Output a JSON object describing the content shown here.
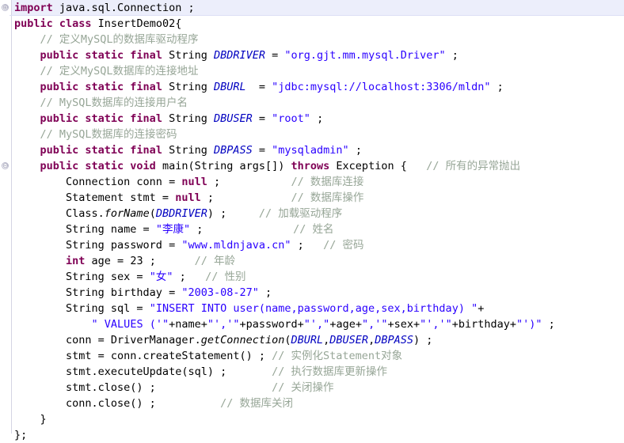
{
  "editor": {
    "name": "java-source-editor",
    "language": "Java",
    "file_class": "InsertDemo02",
    "colors": {
      "background": "#ffffff",
      "current_line_highlight": "#eceefb",
      "keyword": "#7f0055",
      "string": "#2a00ff",
      "comment": "#97a697",
      "field": "#0000c0",
      "plain": "#000000",
      "gutter_rule": "#d4d4e4"
    }
  },
  "gutter": {
    "markers": [
      {
        "line": 1,
        "icon": "fold-expand-icon",
        "glyph": "⊕"
      },
      {
        "line": 11,
        "icon": "fold-collapse-icon",
        "glyph": "⊖"
      }
    ]
  },
  "lines": [
    {
      "n": 1,
      "current": true,
      "tokens": [
        {
          "t": "kw",
          "v": "import"
        },
        {
          "t": "pln",
          "v": " java.sql.Connection ;"
        }
      ]
    },
    {
      "n": 2,
      "tokens": [
        {
          "t": "kw",
          "v": "public class"
        },
        {
          "t": "pln",
          "v": " InsertDemo02{"
        }
      ]
    },
    {
      "n": 3,
      "tokens": [
        {
          "t": "pln",
          "v": "    "
        },
        {
          "t": "cmt",
          "v": "// 定义MySQL的数据库驱动程序"
        }
      ]
    },
    {
      "n": 4,
      "tokens": [
        {
          "t": "pln",
          "v": "    "
        },
        {
          "t": "kw",
          "v": "public static final"
        },
        {
          "t": "pln",
          "v": " String "
        },
        {
          "t": "fld",
          "v": "DBDRIVER"
        },
        {
          "t": "pln",
          "v": " = "
        },
        {
          "t": "str",
          "v": "\"org.gjt.mm.mysql.Driver\""
        },
        {
          "t": "pln",
          "v": " ;"
        }
      ]
    },
    {
      "n": 5,
      "tokens": [
        {
          "t": "pln",
          "v": "    "
        },
        {
          "t": "cmt",
          "v": "// 定义MySQL数据库的连接地址"
        }
      ]
    },
    {
      "n": 6,
      "tokens": [
        {
          "t": "pln",
          "v": "    "
        },
        {
          "t": "kw",
          "v": "public static final"
        },
        {
          "t": "pln",
          "v": " String "
        },
        {
          "t": "fld",
          "v": "DBURL"
        },
        {
          "t": "pln",
          "v": "  = "
        },
        {
          "t": "str",
          "v": "\"jdbc:mysql://localhost:3306/mldn\""
        },
        {
          "t": "pln",
          "v": " ;"
        }
      ]
    },
    {
      "n": 7,
      "tokens": [
        {
          "t": "pln",
          "v": "    "
        },
        {
          "t": "cmt",
          "v": "// MySQL数据库的连接用户名"
        }
      ]
    },
    {
      "n": 8,
      "tokens": [
        {
          "t": "pln",
          "v": "    "
        },
        {
          "t": "kw",
          "v": "public static final"
        },
        {
          "t": "pln",
          "v": " String "
        },
        {
          "t": "fld",
          "v": "DBUSER"
        },
        {
          "t": "pln",
          "v": " = "
        },
        {
          "t": "str",
          "v": "\"root\""
        },
        {
          "t": "pln",
          "v": " ;"
        }
      ]
    },
    {
      "n": 9,
      "tokens": [
        {
          "t": "pln",
          "v": "    "
        },
        {
          "t": "cmt",
          "v": "// MySQL数据库的连接密码"
        }
      ]
    },
    {
      "n": 10,
      "tokens": [
        {
          "t": "pln",
          "v": "    "
        },
        {
          "t": "kw",
          "v": "public static final"
        },
        {
          "t": "pln",
          "v": " String "
        },
        {
          "t": "fld",
          "v": "DBPASS"
        },
        {
          "t": "pln",
          "v": " = "
        },
        {
          "t": "str",
          "v": "\"mysqladmin\""
        },
        {
          "t": "pln",
          "v": " ;"
        }
      ]
    },
    {
      "n": 11,
      "tokens": [
        {
          "t": "pln",
          "v": "    "
        },
        {
          "t": "kw",
          "v": "public static void"
        },
        {
          "t": "pln",
          "v": " main(String args[]) "
        },
        {
          "t": "kw",
          "v": "throws"
        },
        {
          "t": "pln",
          "v": " Exception {   "
        },
        {
          "t": "cmt",
          "v": "// 所有的异常抛出"
        }
      ]
    },
    {
      "n": 12,
      "tokens": [
        {
          "t": "pln",
          "v": "        Connection conn = "
        },
        {
          "t": "kw",
          "v": "null"
        },
        {
          "t": "pln",
          "v": " ;           "
        },
        {
          "t": "cmt",
          "v": "// 数据库连接"
        }
      ]
    },
    {
      "n": 13,
      "tokens": [
        {
          "t": "pln",
          "v": "        Statement stmt = "
        },
        {
          "t": "kw",
          "v": "null"
        },
        {
          "t": "pln",
          "v": " ;            "
        },
        {
          "t": "cmt",
          "v": "// 数据库操作"
        }
      ]
    },
    {
      "n": 14,
      "tokens": [
        {
          "t": "pln",
          "v": "        Class."
        },
        {
          "t": "mth",
          "v": "forName"
        },
        {
          "t": "pln",
          "v": "("
        },
        {
          "t": "fld",
          "v": "DBDRIVER"
        },
        {
          "t": "pln",
          "v": ") ;     "
        },
        {
          "t": "cmt",
          "v": "// 加载驱动程序"
        }
      ]
    },
    {
      "n": 15,
      "tokens": [
        {
          "t": "pln",
          "v": "        String name = "
        },
        {
          "t": "str",
          "v": "\"李康\""
        },
        {
          "t": "pln",
          "v": " ;              "
        },
        {
          "t": "cmt",
          "v": "// 姓名"
        }
      ]
    },
    {
      "n": 16,
      "tokens": [
        {
          "t": "pln",
          "v": "        String password = "
        },
        {
          "t": "str",
          "v": "\"www.mldnjava.cn\""
        },
        {
          "t": "pln",
          "v": " ;   "
        },
        {
          "t": "cmt",
          "v": "// 密码"
        }
      ]
    },
    {
      "n": 17,
      "tokens": [
        {
          "t": "pln",
          "v": "        "
        },
        {
          "t": "kw",
          "v": "int"
        },
        {
          "t": "pln",
          "v": " age = 23 ;      "
        },
        {
          "t": "cmt",
          "v": "// 年龄"
        }
      ]
    },
    {
      "n": 18,
      "tokens": [
        {
          "t": "pln",
          "v": "        String sex = "
        },
        {
          "t": "str",
          "v": "\"女\""
        },
        {
          "t": "pln",
          "v": " ;   "
        },
        {
          "t": "cmt",
          "v": "// 性别"
        }
      ]
    },
    {
      "n": 19,
      "tokens": [
        {
          "t": "pln",
          "v": "        String birthday = "
        },
        {
          "t": "str",
          "v": "\"2003-08-27\""
        },
        {
          "t": "pln",
          "v": " ;"
        }
      ]
    },
    {
      "n": 20,
      "tokens": [
        {
          "t": "pln",
          "v": "        String sql = "
        },
        {
          "t": "str",
          "v": "\"INSERT INTO user(name,password,age,sex,birthday) \""
        },
        {
          "t": "pln",
          "v": "+"
        }
      ]
    },
    {
      "n": 21,
      "tokens": [
        {
          "t": "pln",
          "v": "            "
        },
        {
          "t": "str",
          "v": "\" VALUES ('\""
        },
        {
          "t": "pln",
          "v": "+name+"
        },
        {
          "t": "str",
          "v": "\"','\""
        },
        {
          "t": "pln",
          "v": "+password+"
        },
        {
          "t": "str",
          "v": "\"',\""
        },
        {
          "t": "pln",
          "v": "+age+"
        },
        {
          "t": "str",
          "v": "\",'\""
        },
        {
          "t": "pln",
          "v": "+sex+"
        },
        {
          "t": "str",
          "v": "\"','\""
        },
        {
          "t": "pln",
          "v": "+birthday+"
        },
        {
          "t": "str",
          "v": "\"')\""
        },
        {
          "t": "pln",
          "v": " ;"
        }
      ]
    },
    {
      "n": 22,
      "tokens": [
        {
          "t": "pln",
          "v": "        conn = DriverManager."
        },
        {
          "t": "mth",
          "v": "getConnection"
        },
        {
          "t": "pln",
          "v": "("
        },
        {
          "t": "fld",
          "v": "DBURL"
        },
        {
          "t": "pln",
          "v": ","
        },
        {
          "t": "fld",
          "v": "DBUSER"
        },
        {
          "t": "pln",
          "v": ","
        },
        {
          "t": "fld",
          "v": "DBPASS"
        },
        {
          "t": "pln",
          "v": ") ;"
        }
      ]
    },
    {
      "n": 23,
      "tokens": [
        {
          "t": "pln",
          "v": "        stmt = conn.createStatement() ; "
        },
        {
          "t": "cmt",
          "v": "// 实例化Statement对象"
        }
      ]
    },
    {
      "n": 24,
      "tokens": [
        {
          "t": "pln",
          "v": "        stmt.executeUpdate(sql) ;       "
        },
        {
          "t": "cmt",
          "v": "// 执行数据库更新操作"
        }
      ]
    },
    {
      "n": 25,
      "tokens": [
        {
          "t": "pln",
          "v": "        stmt.close() ;                  "
        },
        {
          "t": "cmt",
          "v": "// 关闭操作"
        }
      ]
    },
    {
      "n": 26,
      "tokens": [
        {
          "t": "pln",
          "v": "        conn.close() ;          "
        },
        {
          "t": "cmt",
          "v": "// 数据库关闭"
        }
      ]
    },
    {
      "n": 27,
      "tokens": [
        {
          "t": "pln",
          "v": "    }"
        }
      ]
    },
    {
      "n": 28,
      "tokens": [
        {
          "t": "pln",
          "v": "};"
        }
      ]
    }
  ]
}
